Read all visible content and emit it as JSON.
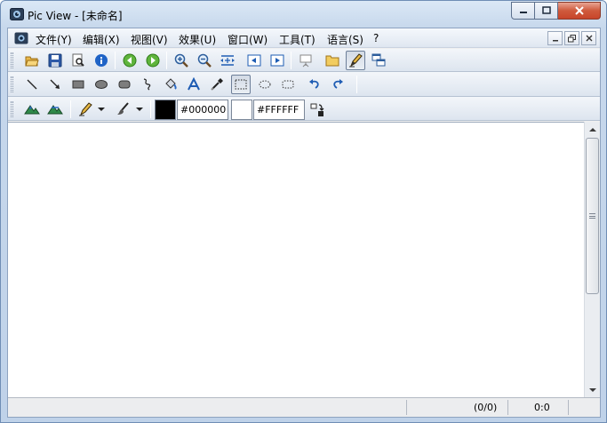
{
  "window": {
    "title": "Pic View - [未命名]"
  },
  "menu": {
    "items": [
      {
        "label": "文件(Y)"
      },
      {
        "label": "编辑(X)"
      },
      {
        "label": "视图(V)"
      },
      {
        "label": "效果(U)"
      },
      {
        "label": "窗口(W)"
      },
      {
        "label": "工具(T)"
      },
      {
        "label": "语言(S)"
      },
      {
        "label": "?"
      }
    ]
  },
  "colors": {
    "foreground_hex": "#000000",
    "background_hex": "#FFFFFF"
  },
  "status": {
    "selection": "(0/0)",
    "position": "0:0"
  }
}
